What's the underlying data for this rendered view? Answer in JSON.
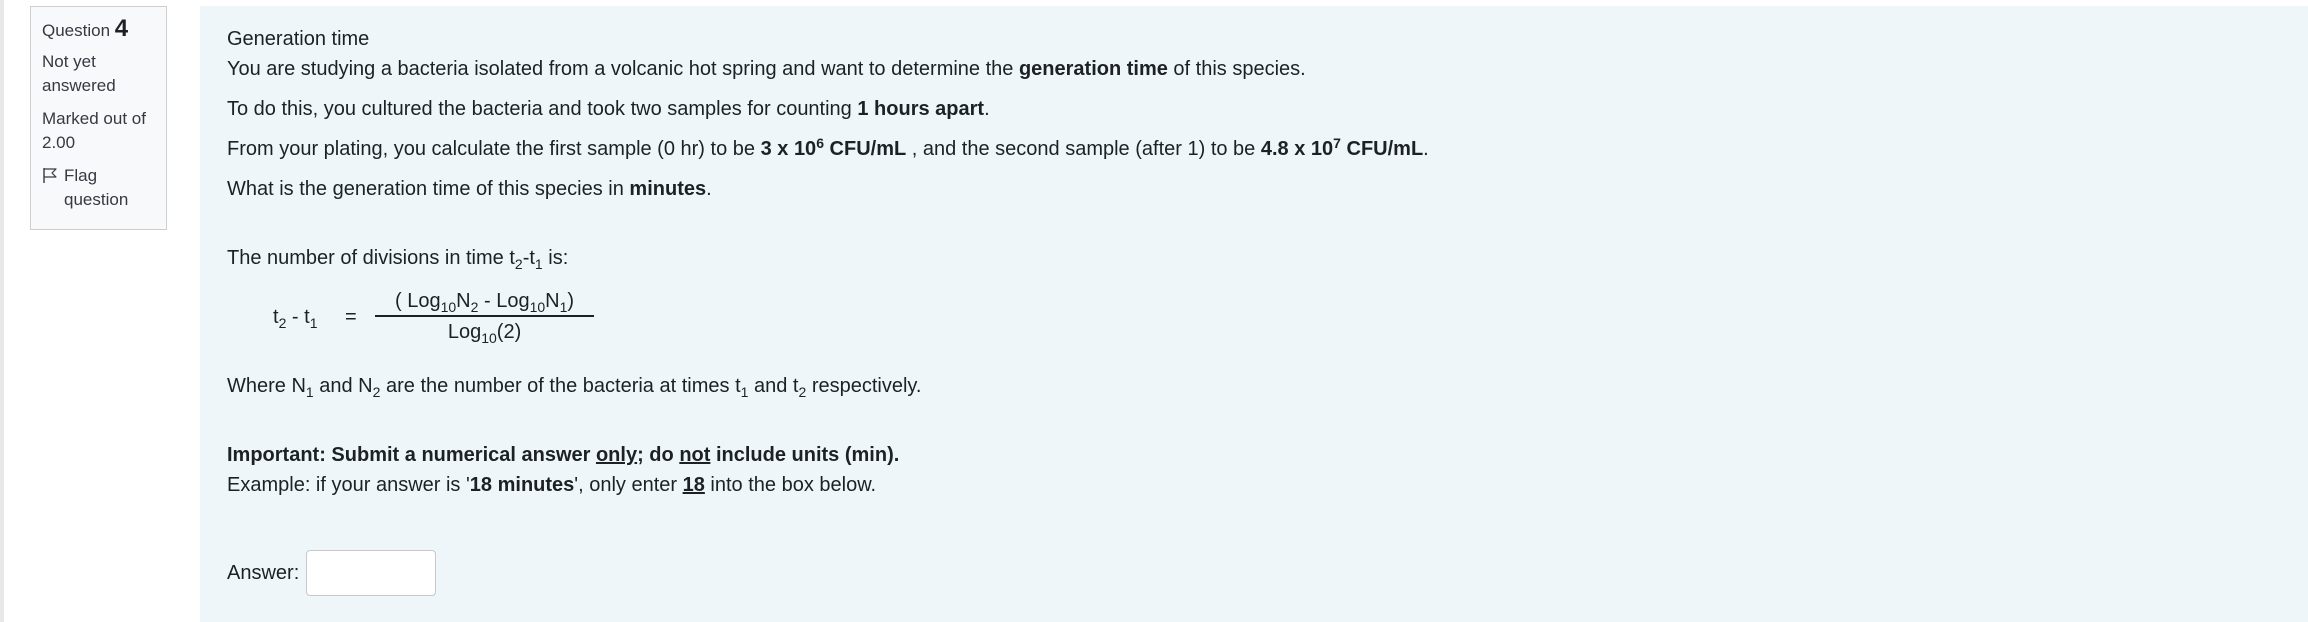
{
  "info": {
    "question_label": "Question",
    "question_number": "4",
    "state": "Not yet answered",
    "grade": "Marked out of 2.00",
    "flag_label": "Flag question"
  },
  "question": {
    "title": "Generation time",
    "p1_a": "You are studying a bacteria isolated from a volcanic hot spring and want to determine the ",
    "p1_b": "generation time",
    "p1_c": " of this species.",
    "p2_a": "To do this, you cultured the bacteria and took two samples for counting ",
    "p2_b": "1 hours apart",
    "p2_c": ".",
    "p3_a": "From your plating, you calculate the first sample (0 hr) to be ",
    "p3_b1": "3 x 10",
    "p3_b1_exp": "6",
    "p3_b1_unit": " CFU/mL",
    "p3_c": " , and the second sample (after 1) to be ",
    "p3_d1": "4.8 x 10",
    "p3_d1_exp": "7",
    "p3_d1_unit": " CFU/mL",
    "p3_e": ".",
    "p4_a": "What is the generation time of this species in ",
    "p4_b": "minutes",
    "p4_c": "."
  },
  "formula": {
    "intro_a": "The number of divisions in time t",
    "intro_s1": "2",
    "intro_b": "-t",
    "intro_s2": "1",
    "intro_c": " is:",
    "lhs_a": "t",
    "lhs_s1": "2",
    "lhs_b": " - t",
    "lhs_s2": "1",
    "equals": "=",
    "num_a": "( Log",
    "num_s1": "10",
    "num_b": "N",
    "num_s2": "2",
    "num_c": " - Log",
    "num_s3": "10",
    "num_d": "N",
    "num_s4": "1",
    "num_e": ")",
    "den_a": "Log",
    "den_s1": "10",
    "den_b": "(2)",
    "where_a": "Where N",
    "where_s1": "1",
    "where_b": " and N",
    "where_s2": "2",
    "where_c": " are the number of the bacteria at times t",
    "where_s3": "1",
    "where_d": " and t",
    "where_s4": "2",
    "where_e": " respectively."
  },
  "important": {
    "a": "Important: Submit a numerical answer ",
    "only": "only",
    "b": "; do ",
    "not": "not",
    "c": " include units (min).",
    "ex_a": "Example: if your answer is '",
    "ex_b": "18 minutes",
    "ex_c": "', only enter ",
    "ex_d": "18",
    "ex_e": " into the box below."
  },
  "answer": {
    "label": "Answer:",
    "value": ""
  }
}
